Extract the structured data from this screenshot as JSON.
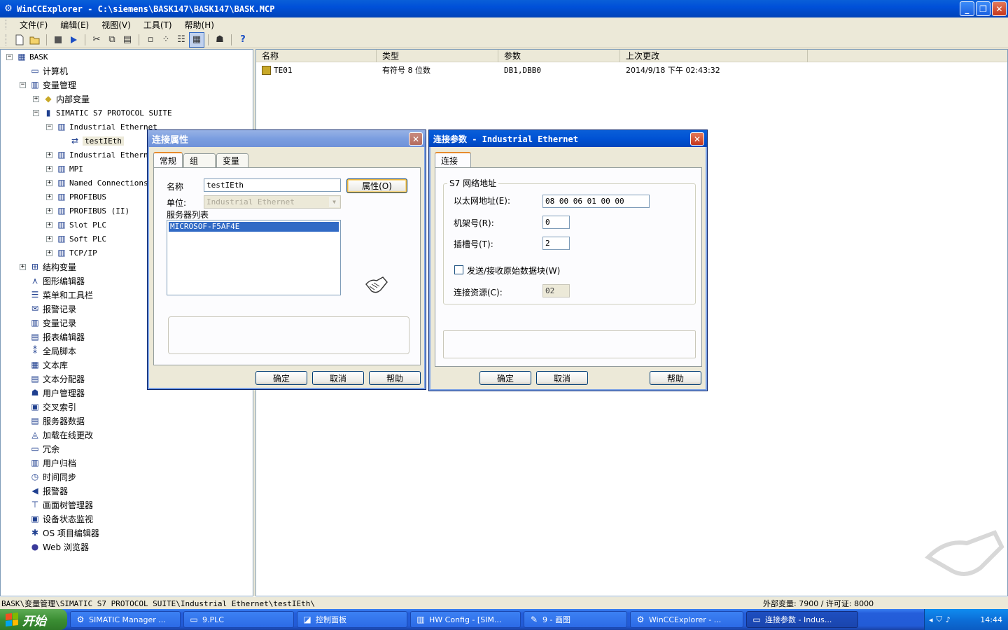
{
  "window": {
    "title": "WinCCExplorer - C:\\siemens\\BASK147\\BASK147\\BASK.MCP",
    "minimize": "_",
    "restore": "❐",
    "close": "✕"
  },
  "menu": [
    "文件(F)",
    "编辑(E)",
    "视图(V)",
    "工具(T)",
    "帮助(H)"
  ],
  "toolbar_icons": [
    "new-icon",
    "open-icon",
    "stop-icon",
    "run-icon",
    "cut-icon",
    "copy-icon",
    "paste-icon",
    "large-icons-icon",
    "small-icons-icon",
    "list-icon",
    "details-icon",
    "properties-icon",
    "help-icon"
  ],
  "tree": [
    {
      "label": "BASK",
      "icon": "project-icon",
      "glyph": "▦",
      "level": 0,
      "exp": "-",
      "mono": true
    },
    {
      "label": "计算机",
      "icon": "computer-icon",
      "glyph": "▭",
      "level": 1,
      "exp": ""
    },
    {
      "label": "变量管理",
      "icon": "tag-management-icon",
      "glyph": "▥",
      "level": 1,
      "exp": "-"
    },
    {
      "label": "内部变量",
      "icon": "internal-tags-icon",
      "glyph": "◆",
      "level": 2,
      "exp": "+"
    },
    {
      "label": "SIMATIC S7 PROTOCOL SUITE",
      "icon": "driver-icon",
      "glyph": "▮",
      "level": 2,
      "exp": "-",
      "mono": true
    },
    {
      "label": "Industrial Ethernet",
      "icon": "channel-unit-icon",
      "glyph": "▥",
      "level": 3,
      "exp": "-",
      "mono": true
    },
    {
      "label": "testIEth",
      "icon": "connection-icon",
      "glyph": "⇄",
      "level": 4,
      "exp": "",
      "mono": true,
      "selected": true
    },
    {
      "label": "Industrial Etherne",
      "icon": "channel-unit-icon",
      "glyph": "▥",
      "level": 3,
      "exp": "+",
      "mono": true
    },
    {
      "label": "MPI",
      "icon": "channel-unit-icon",
      "glyph": "▥",
      "level": 3,
      "exp": "+",
      "mono": true
    },
    {
      "label": "Named Connections",
      "icon": "channel-unit-icon",
      "glyph": "▥",
      "level": 3,
      "exp": "+",
      "mono": true
    },
    {
      "label": "PROFIBUS",
      "icon": "channel-unit-icon",
      "glyph": "▥",
      "level": 3,
      "exp": "+",
      "mono": true
    },
    {
      "label": "PROFIBUS (II)",
      "icon": "channel-unit-icon",
      "glyph": "▥",
      "level": 3,
      "exp": "+",
      "mono": true
    },
    {
      "label": "Slot PLC",
      "icon": "channel-unit-icon",
      "glyph": "▥",
      "level": 3,
      "exp": "+",
      "mono": true
    },
    {
      "label": "Soft PLC",
      "icon": "channel-unit-icon",
      "glyph": "▥",
      "level": 3,
      "exp": "+",
      "mono": true
    },
    {
      "label": "TCP/IP",
      "icon": "channel-unit-icon",
      "glyph": "▥",
      "level": 3,
      "exp": "+",
      "mono": true
    },
    {
      "label": "结构变量",
      "icon": "structure-tags-icon",
      "glyph": "⊞",
      "level": 1,
      "exp": "+"
    },
    {
      "label": "图形编辑器",
      "icon": "graphics-designer-icon",
      "glyph": "⋏",
      "level": 1,
      "exp": ""
    },
    {
      "label": "菜单和工具栏",
      "icon": "menus-toolbars-icon",
      "glyph": "☰",
      "level": 1,
      "exp": ""
    },
    {
      "label": "报警记录",
      "icon": "alarm-logging-icon",
      "glyph": "✉",
      "level": 1,
      "exp": ""
    },
    {
      "label": "变量记录",
      "icon": "tag-logging-icon",
      "glyph": "▥",
      "level": 1,
      "exp": ""
    },
    {
      "label": "报表编辑器",
      "icon": "report-designer-icon",
      "glyph": "▤",
      "level": 1,
      "exp": ""
    },
    {
      "label": "全局脚本",
      "icon": "global-script-icon",
      "glyph": "⁑",
      "level": 1,
      "exp": ""
    },
    {
      "label": "文本库",
      "icon": "text-library-icon",
      "glyph": "▦",
      "level": 1,
      "exp": ""
    },
    {
      "label": "文本分配器",
      "icon": "text-distributor-icon",
      "glyph": "▤",
      "level": 1,
      "exp": ""
    },
    {
      "label": "用户管理器",
      "icon": "user-administrator-icon",
      "glyph": "☗",
      "level": 1,
      "exp": ""
    },
    {
      "label": "交叉索引",
      "icon": "cross-reference-icon",
      "glyph": "▣",
      "level": 1,
      "exp": ""
    },
    {
      "label": "服务器数据",
      "icon": "server-data-icon",
      "glyph": "▤",
      "level": 1,
      "exp": ""
    },
    {
      "label": "加载在线更改",
      "icon": "load-online-changes-icon",
      "glyph": "◬",
      "level": 1,
      "exp": ""
    },
    {
      "label": "冗余",
      "icon": "redundancy-icon",
      "glyph": "▭",
      "level": 1,
      "exp": ""
    },
    {
      "label": "用户归档",
      "icon": "user-archive-icon",
      "glyph": "▥",
      "level": 1,
      "exp": ""
    },
    {
      "label": "时间同步",
      "icon": "time-sync-icon",
      "glyph": "◷",
      "level": 1,
      "exp": ""
    },
    {
      "label": "报警器",
      "icon": "horn-icon",
      "glyph": "◀",
      "level": 1,
      "exp": ""
    },
    {
      "label": "画面树管理器",
      "icon": "picture-tree-icon",
      "glyph": "⊤",
      "level": 1,
      "exp": ""
    },
    {
      "label": "设备状态监视",
      "icon": "lifebeat-monitoring-icon",
      "glyph": "▣",
      "level": 1,
      "exp": ""
    },
    {
      "label": "OS 项目编辑器",
      "icon": "os-project-editor-icon",
      "glyph": "✱",
      "level": 1,
      "exp": ""
    },
    {
      "label": "Web 浏览器",
      "icon": "web-navigator-icon",
      "glyph": "●",
      "level": 1,
      "exp": ""
    }
  ],
  "list": {
    "headers": [
      "名称",
      "类型",
      "参数",
      "上次更改"
    ],
    "rows": [
      {
        "name": "TE01",
        "type": "有符号 8 位数",
        "param": "DB1,DBB0",
        "changed": "2014/9/18 下午 02:43:32"
      }
    ]
  },
  "conn_props": {
    "title": "连接属性",
    "tabs": [
      "常规",
      "组",
      "变量"
    ],
    "name_label": "名称",
    "name_value": "testIEth",
    "properties_btn": "属性(O)",
    "unit_label": "单位:",
    "unit_value": "Industrial Ethernet",
    "server_list_label": "服务器列表",
    "server_item": "MICROSOF-F5AF4E",
    "ok": "确定",
    "cancel": "取消",
    "help": "帮助"
  },
  "conn_params": {
    "title": "连接参数 - Industrial Ethernet",
    "tab": "连接",
    "group_label": "S7 网络地址",
    "eth_label": "以太网地址(E):",
    "eth_value": "08 00 06 01 00 00",
    "rack_label": "机架号(R):",
    "rack_value": "0",
    "slot_label": "插槽号(T):",
    "slot_value": "2",
    "raw_label": "发送/接收原始数据块(W)",
    "res_label": "连接资源(C):",
    "res_value": "02",
    "ok": "确定",
    "cancel": "取消",
    "help": "帮助"
  },
  "status": {
    "path": "BASK\\变量管理\\SIMATIC S7 PROTOCOL SUITE\\Industrial Ethernet\\testIEth\\",
    "license": "外部变量: 7900 / 许可证: 8000"
  },
  "taskbar": {
    "start": "开始",
    "tasks": [
      {
        "label": "SIMATIC Manager ...",
        "icon": "simatic-manager-icon",
        "glyph": "⚙"
      },
      {
        "label": "9.PLC",
        "icon": "folder-icon",
        "glyph": "▭"
      },
      {
        "label": "控制面板",
        "icon": "control-panel-icon",
        "glyph": "◪"
      },
      {
        "label": "HW Config - [SIM...",
        "icon": "hw-config-icon",
        "glyph": "▥"
      },
      {
        "label": "9 - 画图",
        "icon": "paint-icon",
        "glyph": "✎"
      },
      {
        "label": "WinCCExplorer - ...",
        "icon": "wincc-icon",
        "glyph": "⚙"
      },
      {
        "label": "连接参数 - Indus...",
        "icon": "window-icon",
        "glyph": "▭",
        "active": true
      }
    ],
    "clock": "14:44"
  }
}
